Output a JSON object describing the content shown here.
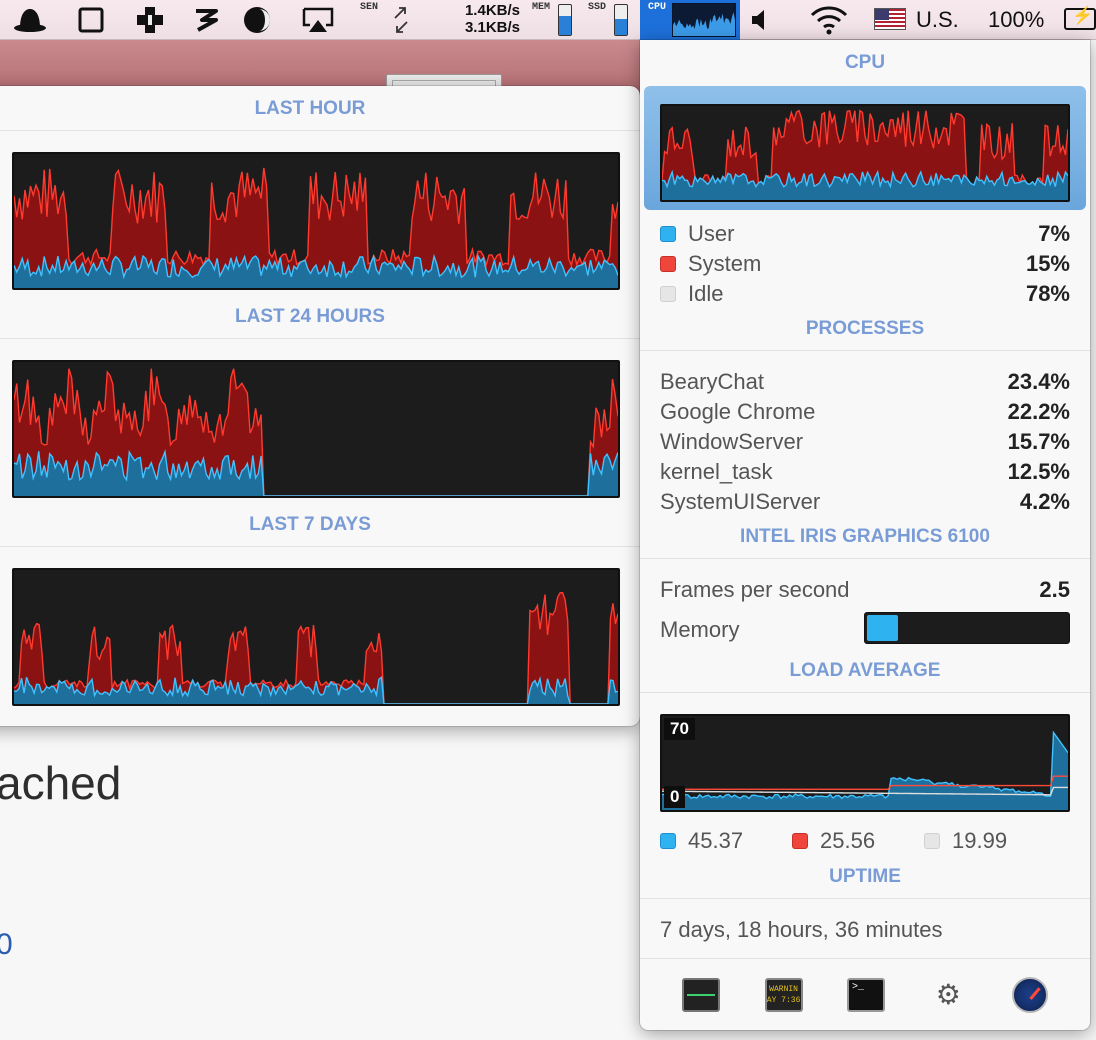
{
  "menubar": {
    "icons": [
      "hat-icon",
      "square-icon",
      "puzzle-icon",
      "z-icon",
      "moon-icon",
      "airplay-icon",
      "sensors-icon",
      "arrows-icon"
    ],
    "network": {
      "up": "1.4KB/s",
      "down": "3.1KB/s"
    },
    "sen_label": "SEN",
    "mem_label": "MEM",
    "ssd_label": "SSD",
    "cpu_label": "CPU",
    "mem_level": 0.62,
    "ssd_level": 0.55,
    "input_source": "U.S.",
    "battery": "100%"
  },
  "background": {
    "heading_fragment": "ached",
    "link_fragment": "0"
  },
  "history": {
    "sections": [
      {
        "title": "LAST HOUR"
      },
      {
        "title": "LAST 24 HOURS"
      },
      {
        "title": "LAST 7 DAYS"
      }
    ]
  },
  "cpu": {
    "title": "CPU",
    "stats": [
      {
        "label": "User",
        "value": "7%",
        "color": "#2fb2f0"
      },
      {
        "label": "System",
        "value": "15%",
        "color": "#f0453a"
      },
      {
        "label": "Idle",
        "value": "78%",
        "color": "#e6e6e6"
      }
    ],
    "processes_title": "PROCESSES",
    "processes": [
      {
        "name": "BearyChat",
        "value": "23.4%"
      },
      {
        "name": "Google Chrome",
        "value": "22.2%"
      },
      {
        "name": "WindowServer",
        "value": "15.7%"
      },
      {
        "name": "kernel_task",
        "value": "12.5%"
      },
      {
        "name": "SystemUIServer",
        "value": "4.2%"
      }
    ],
    "gpu_title": "INTEL IRIS GRAPHICS 6100",
    "fps_label": "Frames per second",
    "fps_value": "2.5",
    "memory_label": "Memory",
    "memory_level": 0.15,
    "load_title": "LOAD AVERAGE",
    "load_max": "70",
    "load_min": "0",
    "load_values": [
      {
        "value": "45.37",
        "color": "#2fb2f0"
      },
      {
        "value": "25.56",
        "color": "#f0453a"
      },
      {
        "value": "19.99",
        "color": "#e6e6e6"
      }
    ],
    "uptime_title": "UPTIME",
    "uptime_value": "7 days, 18 hours, 36 minutes",
    "apps": [
      "activity-monitor-icon",
      "console-icon",
      "terminal-icon",
      "system-information-icon",
      "istat-menus-icon"
    ],
    "console_text": "WARNIN AY 7:36",
    "terminal_text": ">_"
  }
}
